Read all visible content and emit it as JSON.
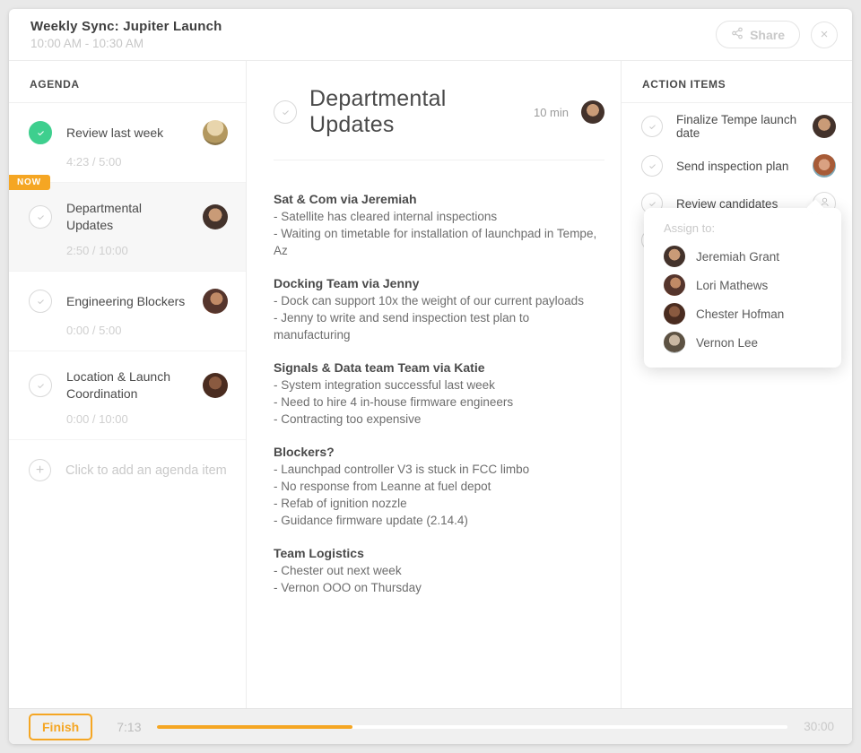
{
  "header": {
    "title": "Weekly Sync: Jupiter Launch",
    "time_range": "10:00 AM - 10:30 AM",
    "share_label": "Share",
    "close_glyph": "×"
  },
  "agenda": {
    "heading": "AGENDA",
    "now_badge": "NOW",
    "add_item_label": "Click to add an agenda item",
    "add_glyph": "+",
    "items": [
      {
        "title": "Review last week",
        "time": "4:23 / 5:00",
        "status": "done"
      },
      {
        "title": "Departmental Updates",
        "time": "2:50 / 10:00",
        "status": "current"
      },
      {
        "title": "Engineering Blockers",
        "time": "0:00 / 5:00",
        "status": "todo"
      },
      {
        "title": "Location & Launch Coordination",
        "time": "0:00 / 10:00",
        "status": "todo"
      }
    ]
  },
  "notes": {
    "title": "Departmental Updates",
    "duration": "10 min",
    "sections": [
      {
        "heading": "Sat & Com via Jeremiah",
        "lines": [
          "- Satellite has cleared internal inspections",
          "- Waiting on timetable for installation of launchpad in Tempe, Az"
        ]
      },
      {
        "heading": "Docking Team via Jenny",
        "lines": [
          "- Dock can support 10x the weight of our current payloads",
          "- Jenny to write and send inspection test plan to manufacturing"
        ]
      },
      {
        "heading": "Signals & Data team Team via Katie",
        "lines": [
          "- System integration successful last week",
          "- Need to hire 4 in-house firmware engineers",
          "- Contracting too expensive"
        ]
      },
      {
        "heading": "Blockers?",
        "lines": [
          "- Launchpad controller V3 is stuck in FCC limbo",
          "- No response from Leanne at fuel depot",
          "- Refab of ignition nozzle",
          "- Guidance firmware update (2.14.4)"
        ]
      },
      {
        "heading": "Team Logistics",
        "lines": [
          "- Chester out next week",
          "- Vernon OOO on Thursday"
        ]
      }
    ]
  },
  "action_items": {
    "heading": "ACTION ITEMS",
    "items": [
      {
        "label": "Finalize Tempe launch date"
      },
      {
        "label": "Send inspection plan"
      },
      {
        "label": "Review candidates"
      }
    ],
    "assign_popup": {
      "title": "Assign to:",
      "people": [
        "Jeremiah Grant",
        "Lori Mathews",
        "Chester Hofman",
        "Vernon Lee"
      ]
    }
  },
  "footer": {
    "finish_label": "Finish",
    "elapsed": "7:13",
    "total": "30:00",
    "progress_percent": 31
  },
  "colors": {
    "accent_orange": "#F5A623",
    "success_green": "#3ECF8E"
  },
  "icons": [
    "share-icon",
    "close-icon",
    "check-icon",
    "plus-icon",
    "person-icon"
  ]
}
